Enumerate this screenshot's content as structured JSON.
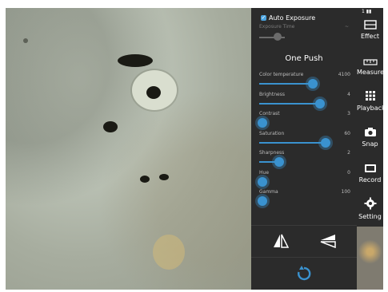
{
  "panel": {
    "auto_exposure_label": "Auto Exposure",
    "exposure_time_label": "Exposure Time",
    "exposure_time_value": "~",
    "one_push_label": "One Push",
    "sliders": [
      {
        "label": "Color temperature",
        "value": "4100",
        "level": 0.6
      },
      {
        "label": "Brightness",
        "value": "4",
        "level": 0.68
      },
      {
        "label": "Contrast",
        "value": "3",
        "level": 0.02
      },
      {
        "label": "Saturation",
        "value": "60",
        "level": 0.74
      },
      {
        "label": "Sharpness",
        "value": "2",
        "level": 0.22
      },
      {
        "label": "Hue",
        "value": "0",
        "level": 0.02
      },
      {
        "label": "Gamma",
        "value": "100",
        "level": 0.02
      }
    ]
  },
  "toolbar": {
    "status": "1 ▮▮",
    "items": [
      {
        "label": "Effect",
        "icon": "effect-icon"
      },
      {
        "label": "Measure",
        "icon": "ruler-icon"
      },
      {
        "label": "Playback",
        "icon": "grid-icon"
      },
      {
        "label": "Snap",
        "icon": "camera-icon"
      },
      {
        "label": "Record",
        "icon": "video-icon"
      },
      {
        "label": "Setting",
        "icon": "gear-icon"
      }
    ]
  },
  "colors": {
    "accent": "#3a92cf",
    "panel": "#2b2b2b"
  }
}
